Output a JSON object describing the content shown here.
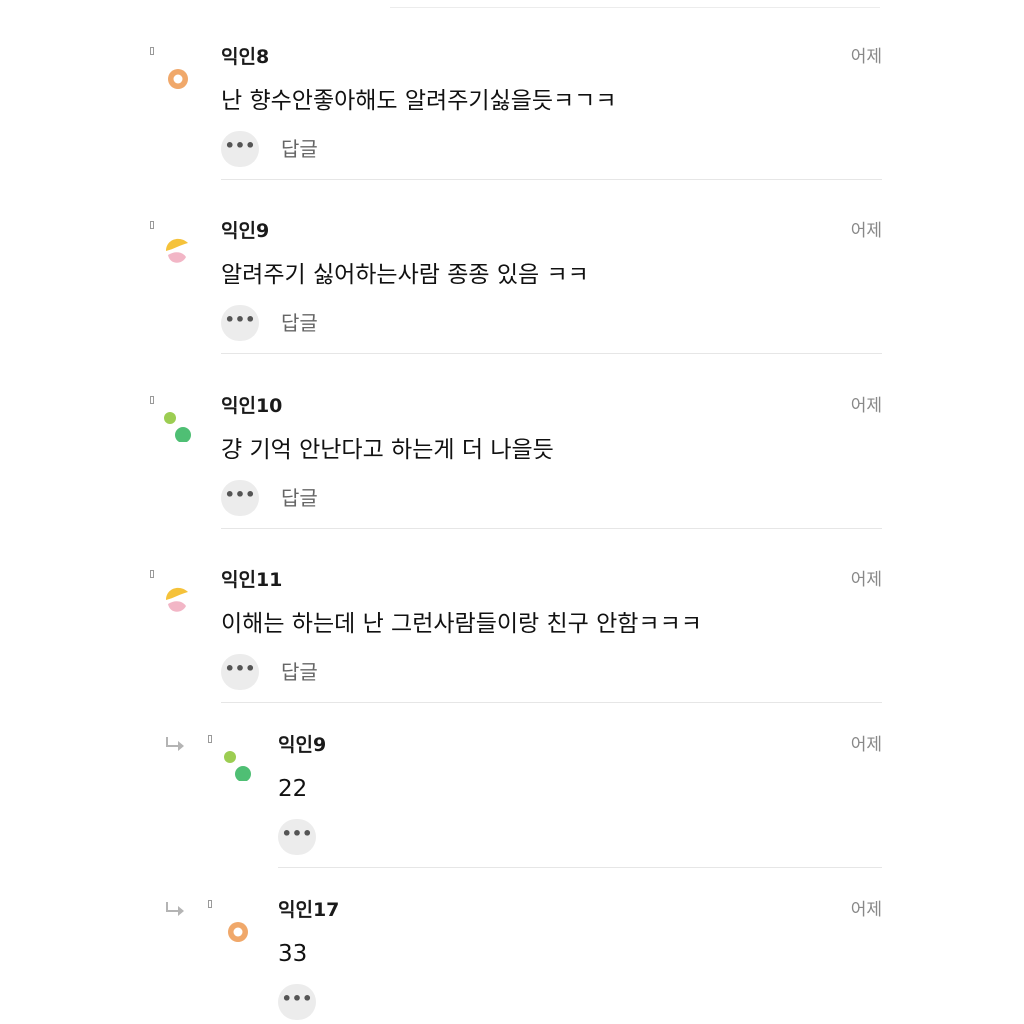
{
  "comments": [
    {
      "nickname": "익인8",
      "time": "어제",
      "content": "난 향수안좋아해도 알려주기싫을듯ㅋㄱㅋ",
      "more_label": "•••",
      "reply_label": "답글",
      "avatar": "orange-ring"
    },
    {
      "nickname": "익인9",
      "time": "어제",
      "content": "알려주기 싫어하는사람 종종 있음 ㅋㅋ",
      "more_label": "•••",
      "reply_label": "답글",
      "avatar": "yellow-pink-blob"
    },
    {
      "nickname": "익인10",
      "time": "어제",
      "content": "걍 기억 안난다고 하는게 더 나을듯",
      "more_label": "•••",
      "reply_label": "답글",
      "avatar": "green-dots"
    },
    {
      "nickname": "익인11",
      "time": "어제",
      "content": "이해는 하는데 난 그런사람들이랑 친구 안함ㅋㅋㅋ",
      "more_label": "•••",
      "reply_label": "답글",
      "avatar": "yellow-pink-blob"
    }
  ],
  "replies": [
    {
      "nickname": "익인9",
      "time": "어제",
      "content": "22",
      "more_label": "•••",
      "avatar": "green-dots"
    },
    {
      "nickname": "익인17",
      "time": "어제",
      "content": "33",
      "more_label": "•••",
      "avatar": "orange-ring"
    }
  ],
  "colors": {
    "avatar_orange": "#f0a86a",
    "avatar_yellow": "#f5c23a",
    "avatar_pink": "#f2b6c6",
    "avatar_green_light": "#9ccd52",
    "avatar_green": "#4fbf74"
  },
  "icons": {
    "reply_arrow": "reply-arrow-icon",
    "more": "more-dots-icon"
  }
}
